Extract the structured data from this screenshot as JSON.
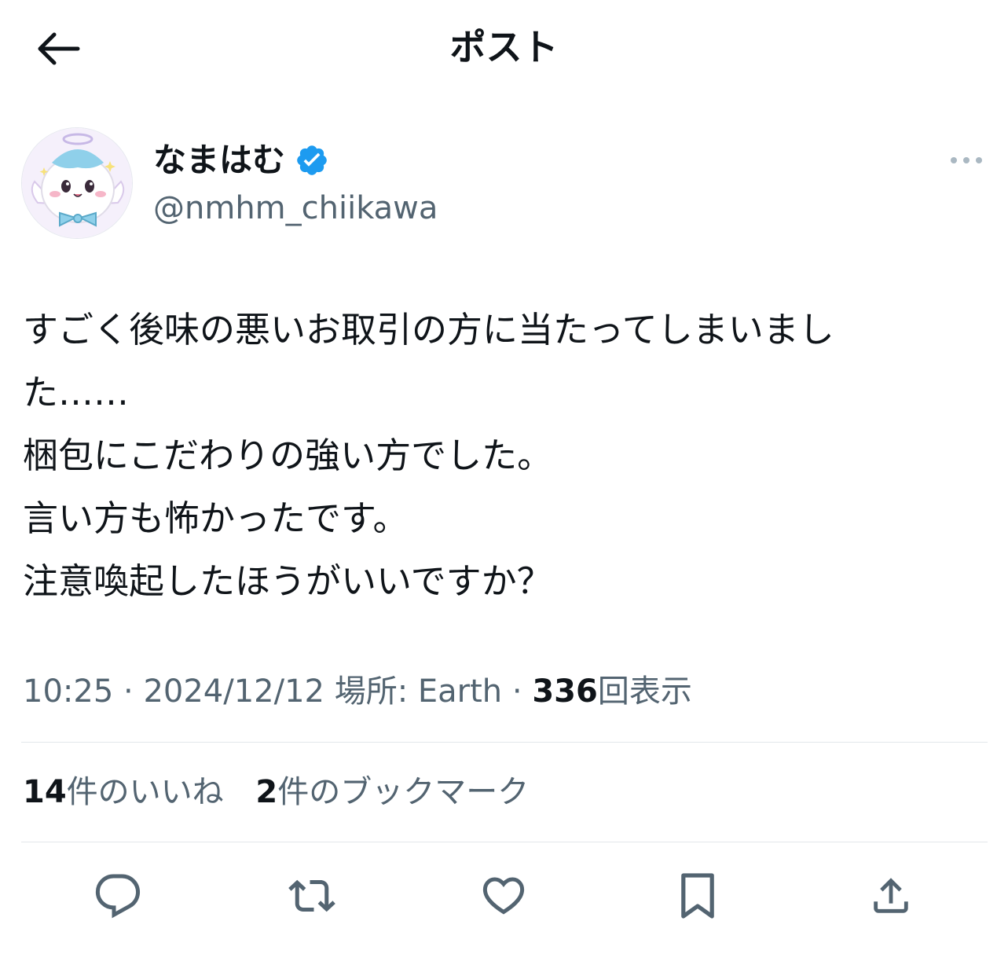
{
  "header": {
    "title": "ポスト",
    "back_icon": "arrow-left-icon"
  },
  "author": {
    "display_name": "なまはむ",
    "handle": "@nmhm_chiikawa",
    "verified_icon": "verified-badge-icon",
    "accent_color": "#1d9bf0"
  },
  "tweet": {
    "text": "すごく後味の悪いお取引の方に当たってしまいまし\nた……\n梱包にこだわりの強い方でした。\n言い方も怖かったです。\n注意喚起したほうがいいですか？"
  },
  "meta": {
    "time": "10:25",
    "separator": "·",
    "date": "2024/12/12",
    "location": "場所: Earth",
    "views_count": "336",
    "views_label": "回表示"
  },
  "stats": {
    "likes_count": "14",
    "likes_label": "件のいいね",
    "bookmarks_count": "2",
    "bookmarks_label": "件のブックマーク"
  },
  "actions": [
    "reply-icon",
    "retweet-icon",
    "like-icon",
    "bookmark-icon",
    "share-icon"
  ],
  "colors": {
    "text": "#0f1419",
    "secondary": "#536471",
    "divider": "#e3e7ea",
    "icon": "#536471"
  }
}
